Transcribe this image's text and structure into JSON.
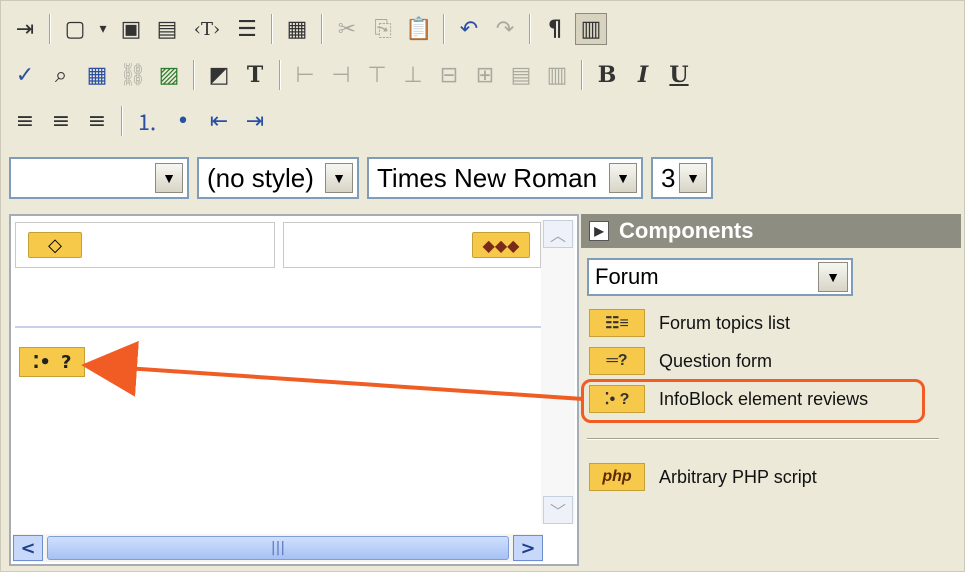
{
  "toolbar": {
    "row1": [
      {
        "name": "exit-icon",
        "glyph": "⇥"
      },
      {
        "name": "new-document-icon",
        "glyph": "▢"
      },
      {
        "name": "dropdown-arrow-icon",
        "glyph": "▾"
      },
      {
        "name": "save-icon",
        "glyph": "▣"
      },
      {
        "name": "save-as-icon",
        "glyph": "▤"
      },
      {
        "name": "template-tag-icon",
        "glyph": "‹T›"
      },
      {
        "name": "page-properties-icon",
        "glyph": "☰"
      },
      {
        "name": "page-source-icon",
        "glyph": "▦"
      },
      {
        "name": "cut-icon",
        "glyph": "✂",
        "disabled": true
      },
      {
        "name": "copy-icon",
        "glyph": "⎘",
        "disabled": true
      },
      {
        "name": "paste-icon",
        "glyph": "📋"
      },
      {
        "name": "undo-icon",
        "glyph": "↶"
      },
      {
        "name": "redo-icon",
        "glyph": "↷",
        "disabled": true
      },
      {
        "name": "paragraph-marks-icon",
        "glyph": "¶"
      },
      {
        "name": "show-borders-icon",
        "glyph": "▥",
        "pressed": true
      }
    ],
    "row2": [
      {
        "name": "spell-check-icon",
        "glyph": "✓"
      },
      {
        "name": "find-icon",
        "glyph": "⌕"
      },
      {
        "name": "insert-table-icon",
        "glyph": "▦"
      },
      {
        "name": "insert-link-icon",
        "glyph": "⛓"
      },
      {
        "name": "insert-image-icon",
        "glyph": "▨"
      },
      {
        "name": "background-color-icon",
        "glyph": "◩"
      },
      {
        "name": "text-color-icon",
        "glyph": "T"
      },
      {
        "name": "insert-row-before-icon",
        "glyph": "⊢",
        "disabled": true
      },
      {
        "name": "insert-row-after-icon",
        "glyph": "⊣",
        "disabled": true
      },
      {
        "name": "insert-column-before-icon",
        "glyph": "⊤",
        "disabled": true
      },
      {
        "name": "insert-column-after-icon",
        "glyph": "⊥",
        "disabled": true
      },
      {
        "name": "delete-row-icon",
        "glyph": "⊟",
        "disabled": true
      },
      {
        "name": "delete-column-icon",
        "glyph": "⊞",
        "disabled": true
      },
      {
        "name": "merge-cells-icon",
        "glyph": "▤",
        "disabled": true
      },
      {
        "name": "split-cell-icon",
        "glyph": "▥",
        "disabled": true
      },
      {
        "name": "bold-icon",
        "glyph": "B",
        "style": "b"
      },
      {
        "name": "italic-icon",
        "glyph": "I",
        "style": "i"
      },
      {
        "name": "underline-icon",
        "glyph": "U",
        "style": "u"
      }
    ],
    "row3": [
      {
        "name": "align-left-icon",
        "glyph": "≡"
      },
      {
        "name": "align-center-icon",
        "glyph": "≡"
      },
      {
        "name": "align-right-icon",
        "glyph": "≡"
      },
      {
        "name": "ordered-list-icon",
        "glyph": "⒈"
      },
      {
        "name": "bullet-list-icon",
        "glyph": "•"
      },
      {
        "name": "outdent-icon",
        "glyph": "⇤"
      },
      {
        "name": "indent-icon",
        "glyph": "⇥"
      }
    ]
  },
  "format": {
    "paragraph_value": "",
    "style_value": "(no style)",
    "font_value": "Times New Roman",
    "size_value": "3"
  },
  "editor": {
    "left_badge": "◇",
    "right_badge": "◆◆◆",
    "inserted_dots": "⁚•",
    "inserted_q": "?",
    "scroll_up": "︿",
    "scroll_down": "﹀",
    "scroll_left": "<",
    "scroll_right": ">",
    "scroll_grip": "|||"
  },
  "components": {
    "header": "Components",
    "category": "Forum",
    "items": [
      {
        "icon": "☷≡",
        "label": "Forum topics list"
      },
      {
        "icon": "═?",
        "label": "Question form"
      },
      {
        "icon": "⁚• ?",
        "label": "InfoBlock element reviews"
      },
      {
        "icon": "php",
        "label": "Arbitrary PHP script"
      }
    ]
  },
  "colors": {
    "annotation": "#f05c24",
    "badge": "#f6c94b",
    "panel_header": "#8e8d82"
  }
}
